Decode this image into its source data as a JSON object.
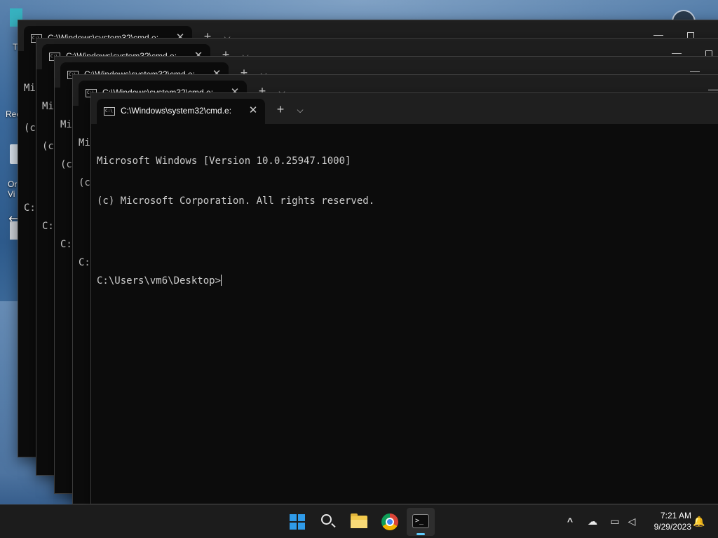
{
  "desktop": {
    "icon_labels": [
      "T",
      "Rec",
      "Or",
      "Vi"
    ]
  },
  "windows": [
    {
      "tab_title": "C:\\Windows\\system32\\cmd.e:",
      "lines": [
        "Mi",
        "(c",
        "",
        "C:"
      ]
    },
    {
      "tab_title": "C:\\Windows\\system32\\cmd.e:",
      "lines": [
        "Mi",
        "(c",
        "",
        "C:"
      ]
    },
    {
      "tab_title": "C:\\Windows\\system32\\cmd.e:",
      "lines": [
        "Mi",
        "(c",
        "",
        "C:"
      ]
    },
    {
      "tab_title": "C:\\Windows\\system32\\cmd.e:",
      "lines": [
        "Mi",
        "(c",
        "",
        "C:"
      ]
    },
    {
      "tab_title": "C:\\Windows\\system32\\cmd.e:",
      "lines": [
        "Microsoft Windows [Version 10.0.25947.1000]",
        "(c) Microsoft Corporation. All rights reserved.",
        "",
        "C:\\Users\\vm6\\Desktop>"
      ]
    }
  ],
  "controls": {
    "close_glyph": "✕",
    "new_tab_glyph": "+",
    "dropdown_glyph": "⌵",
    "minimize_glyph": "—",
    "resize_cursor_glyph": "⟷"
  },
  "taskbar": {
    "apps": [
      "start-icon",
      "search-icon",
      "file-explorer-icon",
      "chrome-icon",
      "terminal-icon"
    ],
    "terminal_glyph": ">_",
    "tray": {
      "overflow_glyph": "^",
      "onedrive_glyph": "☁",
      "network_glyph": "▭",
      "volume_glyph": "◁"
    },
    "time": "7:21 AM",
    "date": "9/29/2023",
    "notification_glyph": "🔔"
  },
  "colors": {
    "terminal_bg": "#0c0c0c",
    "titlebar_bg": "#1f1f1f",
    "taskbar_bg": "#1c1c1c",
    "accent": "#60cdff"
  }
}
